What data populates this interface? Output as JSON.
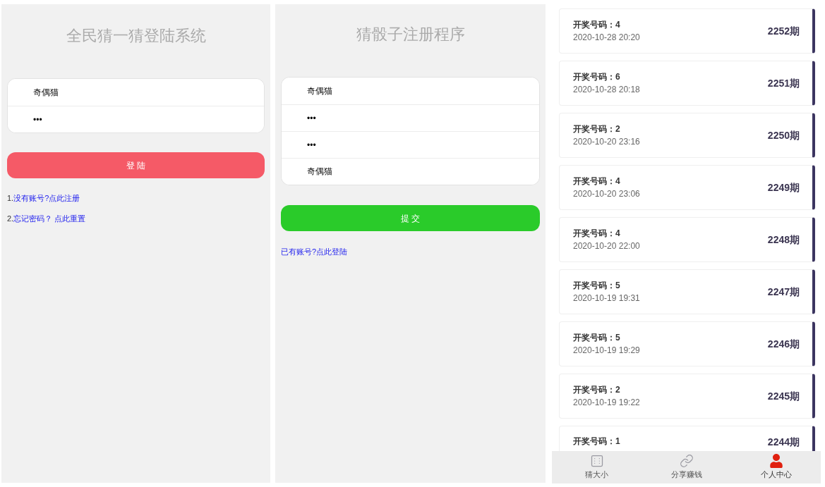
{
  "login": {
    "title": "全民猜一猜登陆系统",
    "fields": [
      {
        "value": "奇偶猫"
      },
      {
        "value": "•••"
      }
    ],
    "button": "登 陆",
    "links": [
      {
        "prefix": "1.",
        "text": "没有账号?点此注册"
      },
      {
        "prefix": "2.",
        "text": "忘记密码？ 点此重置"
      }
    ]
  },
  "register": {
    "title": "猜骰子注册程序",
    "fields": [
      {
        "value": "奇偶猫"
      },
      {
        "value": "•••"
      },
      {
        "value": "•••"
      },
      {
        "value": "奇偶猫"
      }
    ],
    "button": "提 交",
    "link": "已有账号?点此登陆"
  },
  "draws": [
    {
      "label": "开奖号码：",
      "number": "4",
      "time": "2020-10-28 20:20",
      "issue": "2252期"
    },
    {
      "label": "开奖号码：",
      "number": "6",
      "time": "2020-10-28 20:18",
      "issue": "2251期"
    },
    {
      "label": "开奖号码：",
      "number": "2",
      "time": "2020-10-20 23:16",
      "issue": "2250期"
    },
    {
      "label": "开奖号码：",
      "number": "4",
      "time": "2020-10-20 23:06",
      "issue": "2249期"
    },
    {
      "label": "开奖号码：",
      "number": "4",
      "time": "2020-10-20 22:00",
      "issue": "2248期"
    },
    {
      "label": "开奖号码：",
      "number": "5",
      "time": "2020-10-19 19:31",
      "issue": "2247期"
    },
    {
      "label": "开奖号码：",
      "number": "5",
      "time": "2020-10-19 19:29",
      "issue": "2246期"
    },
    {
      "label": "开奖号码：",
      "number": "2",
      "time": "2020-10-19 19:22",
      "issue": "2245期"
    },
    {
      "label": "开奖号码：",
      "number": "1",
      "issue": "2244期"
    }
  ],
  "tab_bar": [
    {
      "kind": "dice",
      "label": "猜大小",
      "selected": false
    },
    {
      "kind": "link",
      "label": "分享赚钱",
      "selected": false
    },
    {
      "kind": "person",
      "label": "个人中心",
      "selected": true
    }
  ]
}
